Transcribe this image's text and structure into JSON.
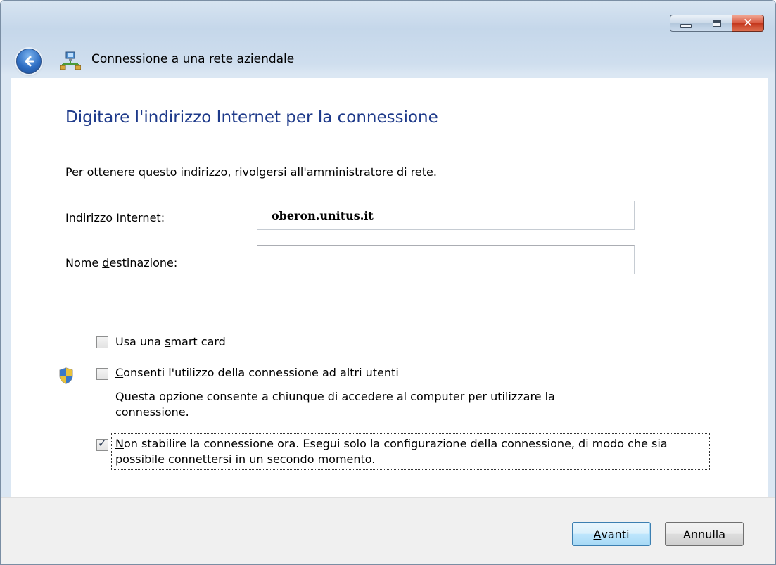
{
  "window": {
    "minimize_label": "minimize",
    "maximize_label": "maximize",
    "close_label": "close"
  },
  "nav": {
    "title": "Connessione a una rete aziendale"
  },
  "main": {
    "heading": "Digitare l'indirizzo Internet per la connessione",
    "instructions": "Per ottenere questo indirizzo, rivolgersi all'amministratore di rete.",
    "internet_address": {
      "label": "Indirizzo Internet:",
      "value": "oberon.unitus.it"
    },
    "destination_name": {
      "label_before": "Nome ",
      "label_underlined": "d",
      "label_after": "estinazione:",
      "value": ""
    },
    "options": {
      "smart_card": {
        "label_before": "Usa una ",
        "label_underlined": "s",
        "label_after": "mart card",
        "checked": false
      },
      "allow_others": {
        "label_underlined": "C",
        "label_after": "onsenti l'utilizzo della connessione ad altri utenti",
        "description": "Questa opzione consente a chiunque di accedere al computer per utilizzare la connessione.",
        "checked": false
      },
      "dont_connect_now": {
        "label_underlined": "N",
        "label_after": "on stabilire la connessione ora. Esegui solo la configurazione della connessione, di modo che sia possibile connettersi in un secondo momento.",
        "checked": true
      }
    }
  },
  "footer": {
    "next_underlined": "A",
    "next_after": "vanti",
    "cancel_label": "Annulla"
  }
}
